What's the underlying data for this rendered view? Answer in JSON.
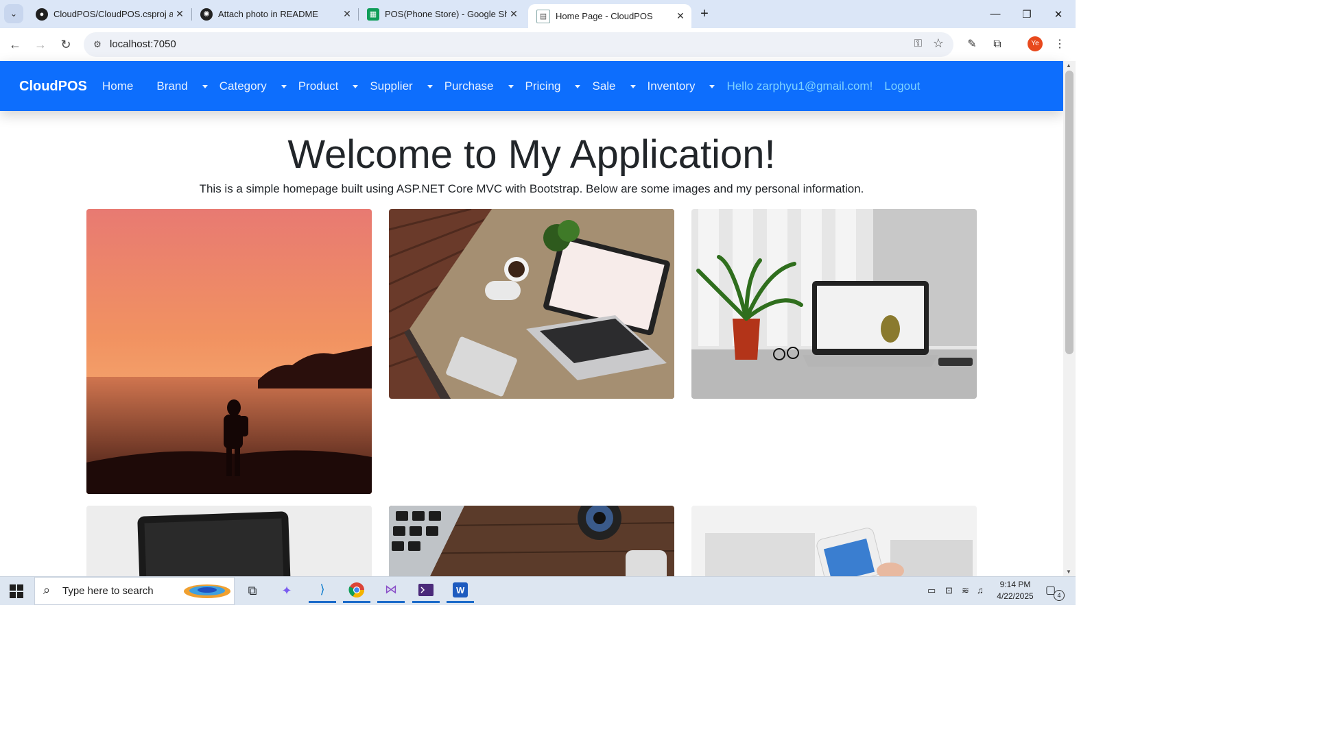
{
  "browser": {
    "tabs": [
      {
        "title": "CloudPOS/CloudPOS.csproj at r",
        "icon": "github-icon"
      },
      {
        "title": "Attach photo in README",
        "icon": "openai-icon"
      },
      {
        "title": "POS(Phone Store) - Google She",
        "icon": "google-sheets-icon"
      },
      {
        "title": "Home Page - CloudPOS",
        "icon": "page-icon",
        "active": true
      }
    ],
    "url": "localhost:7050",
    "profile_initials": "Ye"
  },
  "navbar": {
    "brand": "CloudPOS",
    "items": [
      {
        "label": "Home",
        "dropdown": false
      },
      {
        "label": "Brand",
        "dropdown": true
      },
      {
        "label": "Category",
        "dropdown": true
      },
      {
        "label": "Product",
        "dropdown": true
      },
      {
        "label": "Supplier",
        "dropdown": true
      },
      {
        "label": "Purchase",
        "dropdown": true
      },
      {
        "label": "Pricing",
        "dropdown": true
      },
      {
        "label": "Sale",
        "dropdown": true
      },
      {
        "label": "Inventory",
        "dropdown": true
      }
    ],
    "greeting": "Hello zarphyu1@gmail.com!",
    "logout": "Logout",
    "color": "#0d6efd"
  },
  "main": {
    "heading": "Welcome to My Application!",
    "lead": "This is a simple homepage built using ASP.NET Core MVC with Bootstrap. Below are some images and my personal information.",
    "images": [
      "sunset-beach-photo",
      "laptop-desk-photo",
      "laptop-plant-photo",
      "laptop-dark-photo",
      "keyboard-camera-photo",
      "phone-blur-photo"
    ]
  },
  "taskbar": {
    "search_placeholder": "Type here to search",
    "time": "9:14 PM",
    "date": "4/22/2025",
    "notification_count": "4"
  }
}
